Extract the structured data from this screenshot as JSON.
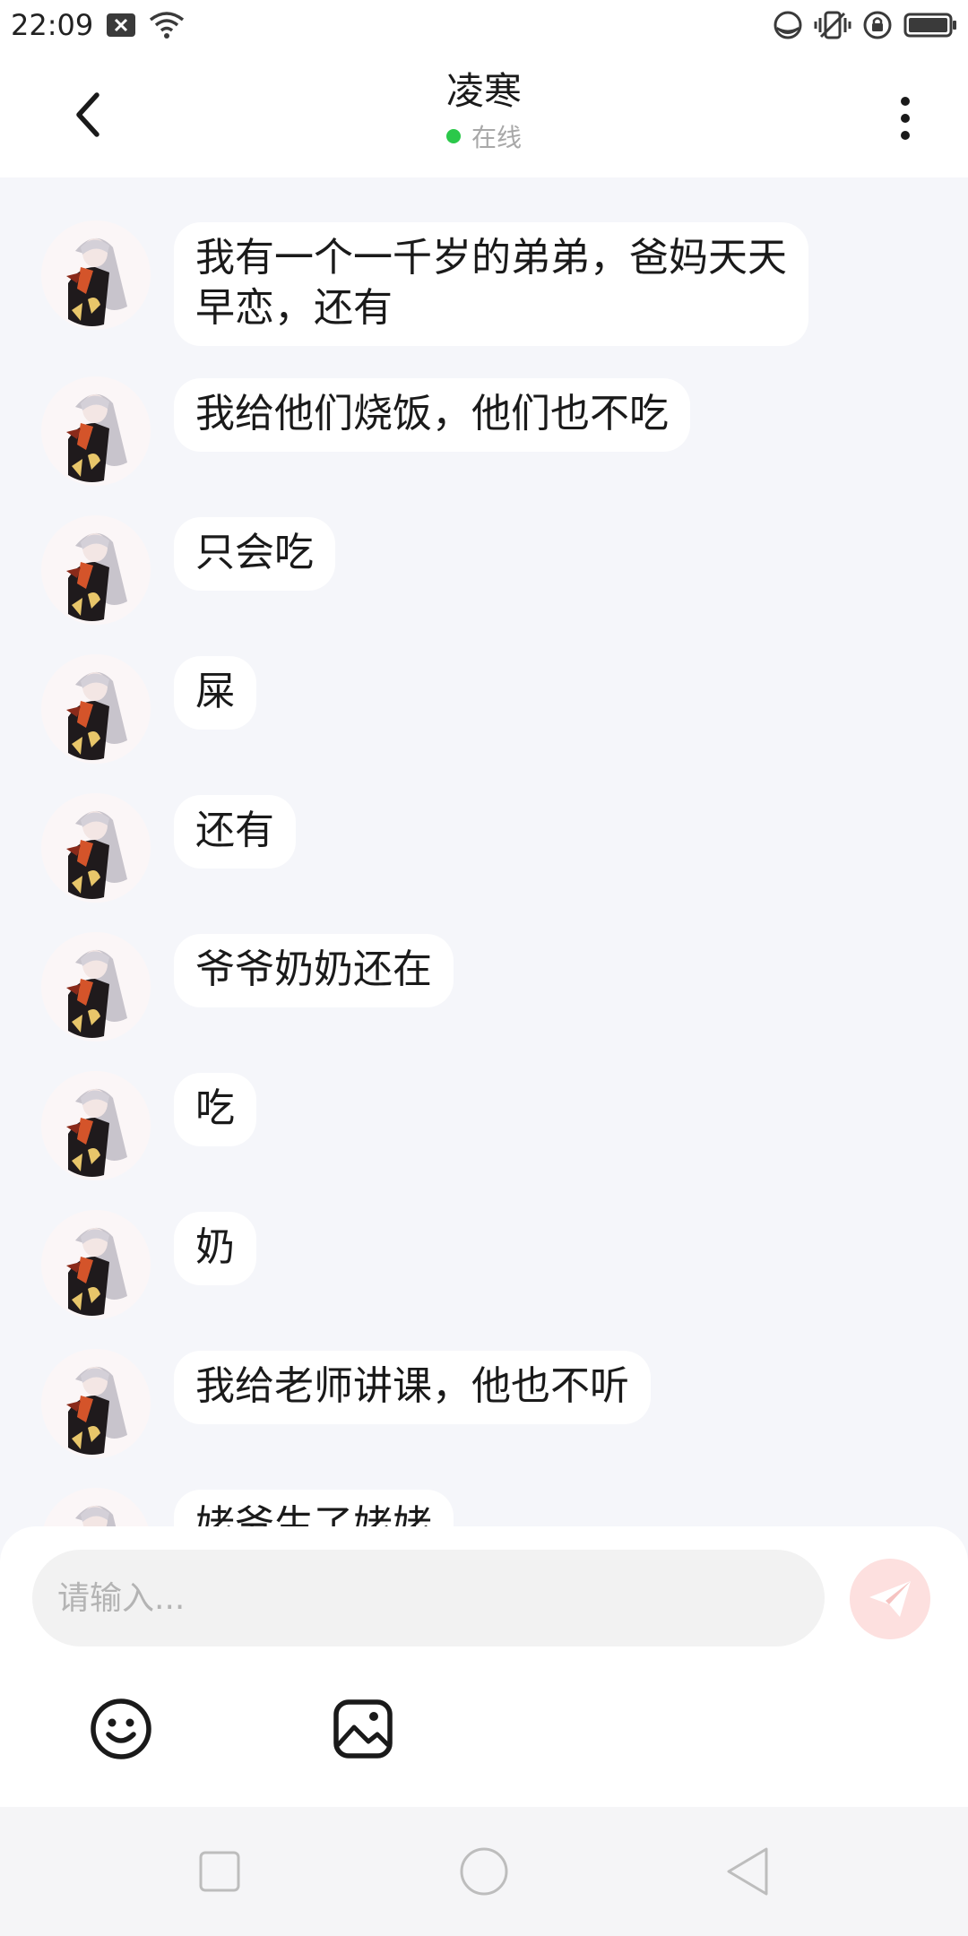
{
  "status_bar": {
    "time": "22:09",
    "icons": [
      "notification-x-icon",
      "wifi-icon",
      "data-saver-icon",
      "vibrate-icon",
      "lock-rotation-icon",
      "battery-icon"
    ]
  },
  "header": {
    "title": "凌寒",
    "presence": "在线",
    "presence_color": "#2bc84a"
  },
  "messages": [
    {
      "text": "我有一个一千岁的弟弟，爸妈天天早恋，还有"
    },
    {
      "text": "我给他们烧饭，他们也不吃"
    },
    {
      "text": "只会吃"
    },
    {
      "text": "屎"
    },
    {
      "text": "还有"
    },
    {
      "text": "爷爷奶奶还在"
    },
    {
      "text": "吃"
    },
    {
      "text": "奶"
    },
    {
      "text": "我给老师讲课，他也不听"
    },
    {
      "text": "姥爷生了姥姥"
    }
  ],
  "composer": {
    "placeholder": "请输入...",
    "send_color": "#fde0df",
    "tools": [
      "emoji-icon",
      "image-icon"
    ]
  },
  "navbar": {
    "buttons": [
      "recent-apps-icon",
      "home-icon",
      "back-icon"
    ]
  },
  "colors": {
    "background": "#f5f6fa",
    "bubble": "#ffffff",
    "accent": "#f08a86"
  }
}
